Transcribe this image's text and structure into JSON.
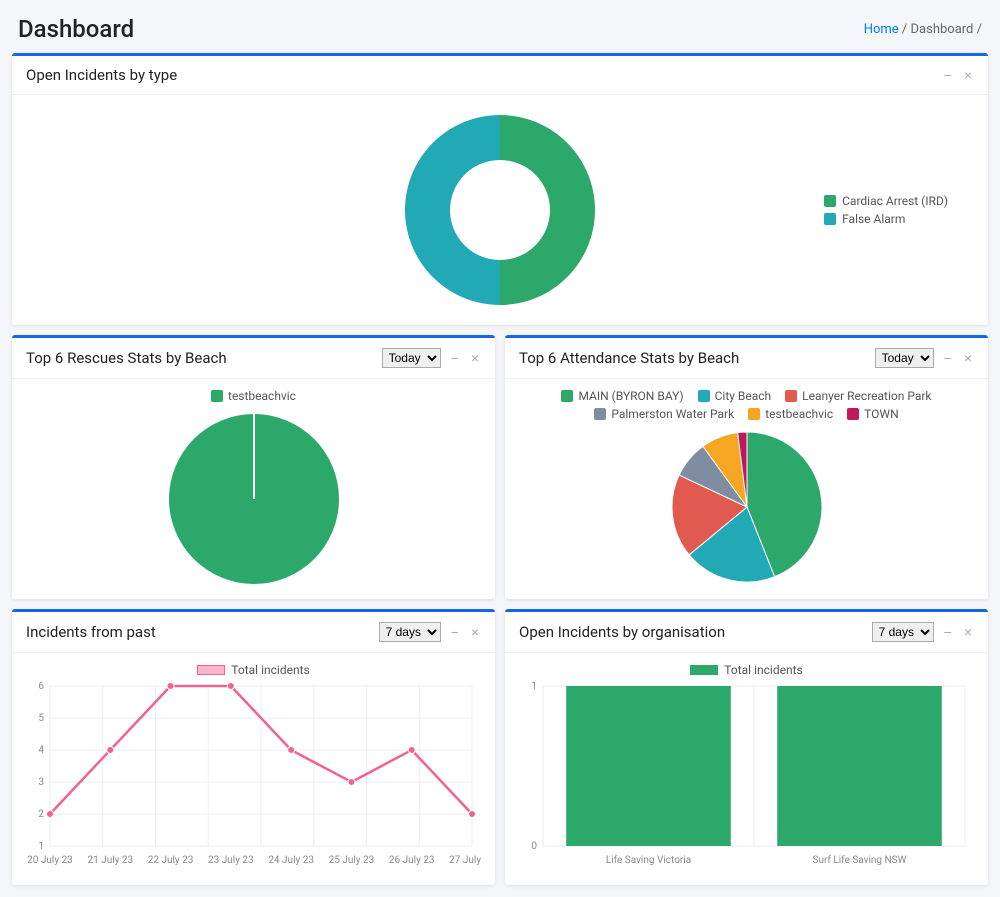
{
  "page_title": "Dashboard",
  "breadcrumb": {
    "home": "Home",
    "current": "Dashboard"
  },
  "colors": {
    "green": "#2ca96a",
    "teal": "#21a9b6",
    "red": "#e25a4f",
    "slate": "#7f8da3",
    "orange": "#f5a623",
    "magenta": "#c2185b",
    "pink": "#f06292",
    "grid": "#eeeeee"
  },
  "cards": {
    "open_by_type": {
      "title": "Open Incidents by type",
      "legend": [
        {
          "label": "Cardiac Arrest (IRD)",
          "color": "#2ca96a"
        },
        {
          "label": "False Alarm",
          "color": "#21a9b6"
        }
      ]
    },
    "rescues": {
      "title": "Top 6 Rescues Stats by Beach",
      "dropdown": "Today",
      "legend": [
        {
          "label": "testbeachvic",
          "color": "#2ca96a"
        }
      ]
    },
    "attendance": {
      "title": "Top 6 Attendance Stats by Beach",
      "dropdown": "Today",
      "legend": [
        {
          "label": "MAIN (BYRON BAY)",
          "color": "#2ca96a"
        },
        {
          "label": "City Beach",
          "color": "#21a9b6"
        },
        {
          "label": "Leanyer Recreation Park",
          "color": "#e25a4f"
        },
        {
          "label": "Palmerston Water Park",
          "color": "#7f8da3"
        },
        {
          "label": "testbeachvic",
          "color": "#f5a623"
        },
        {
          "label": "TOWN",
          "color": "#c2185b"
        }
      ]
    },
    "incidents_past": {
      "title": "Incidents from past",
      "dropdown": "7 days",
      "series_label": "Total incidents"
    },
    "open_by_org": {
      "title": "Open Incidents by organisation",
      "dropdown": "7 days",
      "series_label": "Total incidents"
    }
  },
  "chart_data": [
    {
      "id": "open_by_type",
      "type": "pie",
      "title": "Open Incidents by type",
      "donut": true,
      "series": [
        {
          "name": "Cardiac Arrest (IRD)",
          "value": 50,
          "color": "#2ca96a"
        },
        {
          "name": "False Alarm",
          "value": 50,
          "color": "#21a9b6"
        }
      ]
    },
    {
      "id": "rescues",
      "type": "pie",
      "title": "Top 6 Rescues Stats by Beach",
      "series": [
        {
          "name": "testbeachvic",
          "value": 100,
          "color": "#2ca96a"
        }
      ]
    },
    {
      "id": "attendance",
      "type": "pie",
      "title": "Top 6 Attendance Stats by Beach",
      "series": [
        {
          "name": "MAIN (BYRON BAY)",
          "value": 44,
          "color": "#2ca96a"
        },
        {
          "name": "City Beach",
          "value": 20,
          "color": "#21a9b6"
        },
        {
          "name": "Leanyer Recreation Park",
          "value": 18,
          "color": "#e25a4f"
        },
        {
          "name": "Palmerston Water Park",
          "value": 8,
          "color": "#7f8da3"
        },
        {
          "name": "testbeachvic",
          "value": 8,
          "color": "#f5a623"
        },
        {
          "name": "TOWN",
          "value": 2,
          "color": "#c2185b"
        }
      ]
    },
    {
      "id": "incidents_past",
      "type": "line",
      "title": "Incidents from past",
      "x": [
        "20 July 23",
        "21 July 23",
        "22 July 23",
        "23 July 23",
        "24 July 23",
        "25 July 23",
        "26 July 23",
        "27 July 23"
      ],
      "series": [
        {
          "name": "Total incidents",
          "values": [
            2,
            4,
            6,
            6,
            4,
            3,
            4,
            2
          ],
          "color": "#f06292"
        }
      ],
      "ylim": [
        1,
        6
      ],
      "yticks": [
        1,
        2,
        3,
        4,
        5,
        6
      ]
    },
    {
      "id": "open_by_org",
      "type": "bar",
      "title": "Open Incidents by organisation",
      "categories": [
        "Life Saving Victoria",
        "Surf Life Saving NSW"
      ],
      "series": [
        {
          "name": "Total incidents",
          "values": [
            1,
            1
          ],
          "color": "#2ca96a"
        }
      ],
      "ylim": [
        0,
        1
      ],
      "yticks": [
        0,
        1
      ]
    }
  ]
}
